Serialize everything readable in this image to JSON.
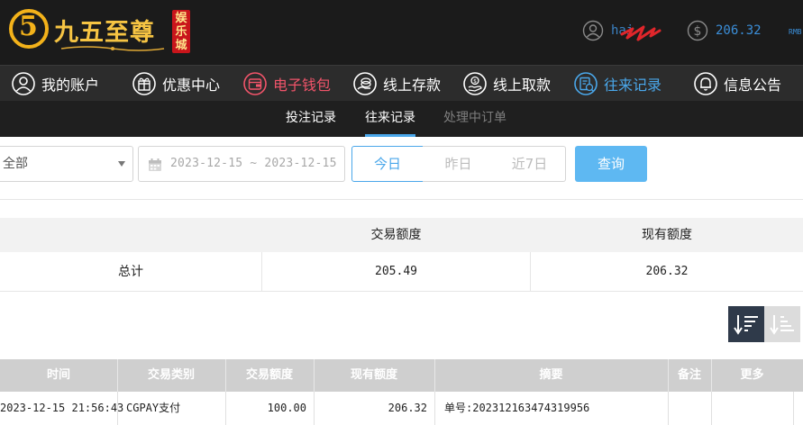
{
  "header": {
    "logo_char": "5",
    "logo_text": "九五至尊",
    "logo_badge": "娱乐城",
    "username": "hai",
    "balance": "206.32",
    "balance_unit": "RMB"
  },
  "nav": {
    "items": [
      {
        "label": "我的账户",
        "icon": "user-circle-icon"
      },
      {
        "label": "优惠中心",
        "icon": "gift-icon"
      },
      {
        "label": "电子钱包",
        "icon": "wallet-icon"
      },
      {
        "label": "线上存款",
        "icon": "deposit-icon"
      },
      {
        "label": "线上取款",
        "icon": "withdraw-icon"
      },
      {
        "label": "往来记录",
        "icon": "records-icon"
      },
      {
        "label": "信息公告",
        "icon": "bell-icon"
      }
    ],
    "active": "往来记录"
  },
  "subnav": {
    "tabs": [
      "投注记录",
      "往来记录",
      "处理中订单"
    ],
    "active": "往来记录"
  },
  "filters": {
    "type_value": "全部",
    "date_range": "2023-12-15 ~ 2023-12-15",
    "quick": [
      "今日",
      "昨日",
      "近7日"
    ],
    "quick_active": "今日",
    "query_label": "查询"
  },
  "summary": {
    "headers": [
      "交易额度",
      "现有额度"
    ],
    "row_label": "总计",
    "trade_amount": "205.49",
    "current_amount": "206.32"
  },
  "records": {
    "headers": [
      "时间",
      "交易类别",
      "交易额度",
      "现有额度",
      "摘要",
      "备注",
      "更多"
    ],
    "rows": [
      {
        "time": "2023-12-15 21:56:43",
        "type": "CGPAY支付",
        "amount": "100.00",
        "balance": "206.32",
        "summary": "单号:202312163474319956",
        "note": "",
        "more": ""
      }
    ]
  },
  "colors": {
    "accent": "#4aa7ea",
    "wallet_nav": "#f1546a",
    "logo_gold": "#f3b21a",
    "query_button": "#5eb8f2"
  }
}
